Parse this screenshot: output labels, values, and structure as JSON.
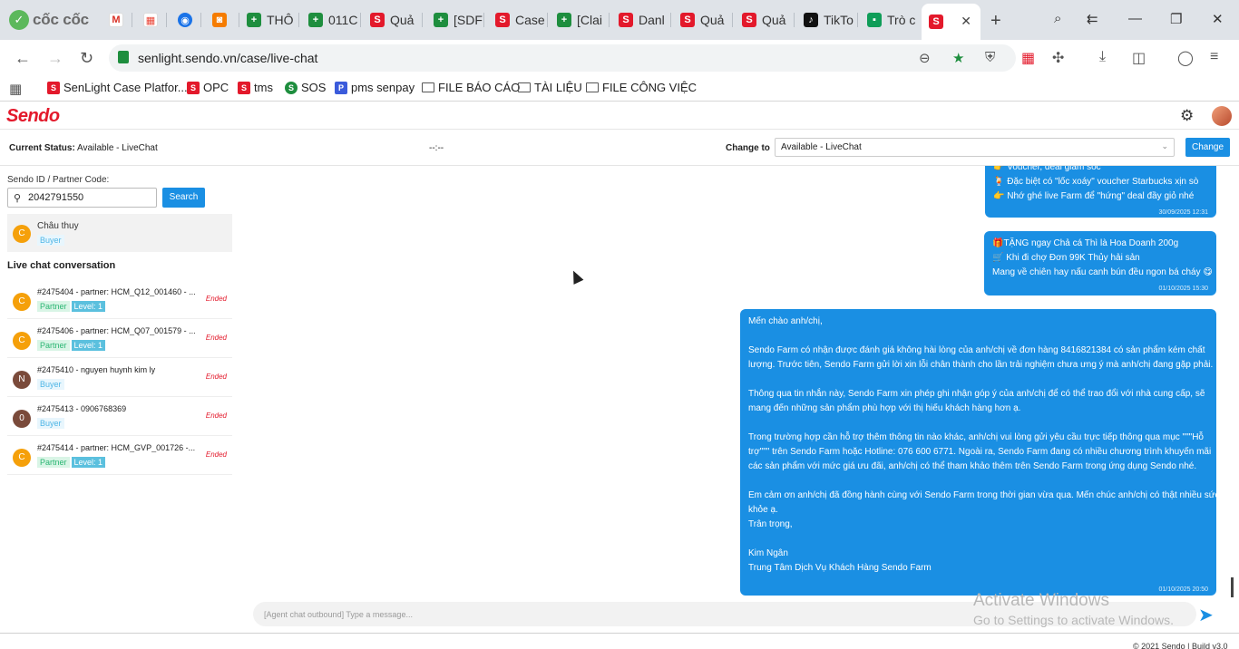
{
  "browser": {
    "name": "cốc cốc",
    "tabs": [
      {
        "label": "",
        "icon": "gmail-icon"
      },
      {
        "label": "",
        "icon": "calendar-icon"
      },
      {
        "label": "",
        "icon": "messenger-icon"
      },
      {
        "label": "",
        "icon": "camera-icon"
      },
      {
        "label": "THÔ",
        "icon": "sheets-icon"
      },
      {
        "label": "011C",
        "icon": "sheets-icon"
      },
      {
        "label": "Quả",
        "icon": "sendo-icon"
      },
      {
        "label": "[SDF",
        "icon": "sheets-icon"
      },
      {
        "label": "Case",
        "icon": "sendo-icon"
      },
      {
        "label": "[Clai",
        "icon": "sheets-icon"
      },
      {
        "label": "Danl",
        "icon": "sendo-icon"
      },
      {
        "label": "Quả",
        "icon": "sendo-icon"
      },
      {
        "label": "Quả",
        "icon": "sendo-icon"
      },
      {
        "label": "TikTo",
        "icon": "tiktok-icon"
      },
      {
        "label": "Trò c",
        "icon": "chat-icon"
      },
      {
        "label": "",
        "icon": "sendo-icon",
        "active": true
      }
    ],
    "url": "senlight.sendo.vn/case/live-chat",
    "bookmarks": [
      {
        "label": "SenLight Case Platfor...",
        "icon": "sendo-icon"
      },
      {
        "label": "OPC",
        "icon": "sendo-icon"
      },
      {
        "label": "tms",
        "icon": "sendo-icon"
      },
      {
        "label": "SOS",
        "icon": "sos-icon"
      },
      {
        "label": "pms senpay",
        "icon": "senpay-icon"
      },
      {
        "label": "FILE BÁO CÁO",
        "icon": "folder-icon"
      },
      {
        "label": "TÀI LIỆU",
        "icon": "folder-icon"
      },
      {
        "label": "FILE CÔNG VIỆC",
        "icon": "folder-icon"
      }
    ]
  },
  "app": {
    "logo": "Sendo",
    "status_bar": {
      "current_label": "Current Status:",
      "current_value": "Available - LiveChat",
      "timer": "--:--",
      "change_to_label": "Change to",
      "change_to_value": "Available - LiveChat",
      "change_button": "Change"
    },
    "left": {
      "sendo_id_label": "Sendo ID / Partner Code:",
      "sendo_id_value": "2042791550",
      "search_button": "Search",
      "buyer": {
        "initial": "C",
        "name": "Châu thuy",
        "role": "Buyer"
      },
      "live_chat_title": "Live chat conversation",
      "conversations": [
        {
          "initial": "C",
          "title": "#2475404 - partner: HCM_Q12_001460 - ...",
          "tags": [
            "Partner",
            "Level: 1"
          ],
          "status": "Ended"
        },
        {
          "initial": "C",
          "title": "#2475406 - partner: HCM_Q07_001579 - ...",
          "tags": [
            "Partner",
            "Level: 1"
          ],
          "status": "Ended"
        },
        {
          "initial": "N",
          "title": "#2475410 - nguyen huynh kim ly",
          "tags": [
            "Buyer"
          ],
          "status": "Ended"
        },
        {
          "initial": "0",
          "title": "#2475413 - 0906768369",
          "tags": [
            "Buyer"
          ],
          "status": "Ended"
        },
        {
          "initial": "C",
          "title": "#2475414 - partner: HCM_GVP_001726 -...",
          "tags": [
            "Partner",
            "Level: 1"
          ],
          "status": "Ended"
        }
      ]
    },
    "chat": {
      "messages": [
        {
          "lines": [
            "👉 Voucher, deal giảm sốc",
            "🍹 Đặc biệt có \"lốc xoáy\" voucher Starbucks xịn sò",
            "👉 Nhớ ghé live Farm để \"hứng\" deal đầy giỏ nhé"
          ],
          "time": "30/09/2025 12:31"
        },
        {
          "lines": [
            "🎁TẶNG ngay Chả cá Thì là Hoa Doanh 200g",
            "🛒 Khi đi chợ Đơn 99K Thủy hải sản",
            "Mang về chiên hay nấu canh bún đều ngon bá cháy 😋"
          ],
          "time": "01/10/2025 15:30"
        },
        {
          "lines": [
            "Mến chào anh/chị,",
            "",
            "Sendo Farm có nhận được đánh giá không hài lòng của anh/chị về đơn hàng 8416821384 có sản phẩm kém chất",
            "lượng. Trước tiên, Sendo Farm gửi lời xin lỗi chân thành cho lần trải nghiệm chưa ưng ý mà anh/chị đang gặp phải.",
            "",
            "Thông qua tin nhắn này, Sendo Farm xin phép ghi nhận góp ý của anh/chị để có thể trao đổi với nhà cung cấp, sẽ",
            "mang đến những sản phẩm phù hợp với thị hiếu khách hàng hơn ạ.",
            "",
            "Trong trường hợp cần hỗ trợ thêm thông tin nào khác, anh/chị vui lòng gửi yêu cầu trực tiếp thông qua mục \"\"\"Hỗ",
            "trợ\"\"\" trên Sendo Farm hoặc Hotline: 076 600 6771. Ngoài ra, Sendo Farm đang có nhiều chương trình khuyến mãi",
            "các sản phẩm với mức giá ưu đãi, anh/chị có thể tham khảo thêm trên Sendo Farm trong ứng dụng Sendo nhé.",
            "",
            "Em cảm ơn anh/chị đã đồng hành cùng với Sendo Farm trong thời gian vừa qua. Mến chúc anh/chị có thật nhiều sức",
            "khỏe ạ.",
            "Trân trọng,",
            "",
            "Kim Ngân",
            "Trung Tâm Dịch Vụ Khách Hàng Sendo Farm"
          ],
          "time": "01/10/2025 20:50"
        }
      ],
      "composer_placeholder": "[Agent chat outbound] Type a message..."
    },
    "watermark": {
      "line1": "Activate Windows",
      "line2": "Go to Settings to activate Windows."
    },
    "footer": "© 2021 Sendo | Build v3.0"
  }
}
